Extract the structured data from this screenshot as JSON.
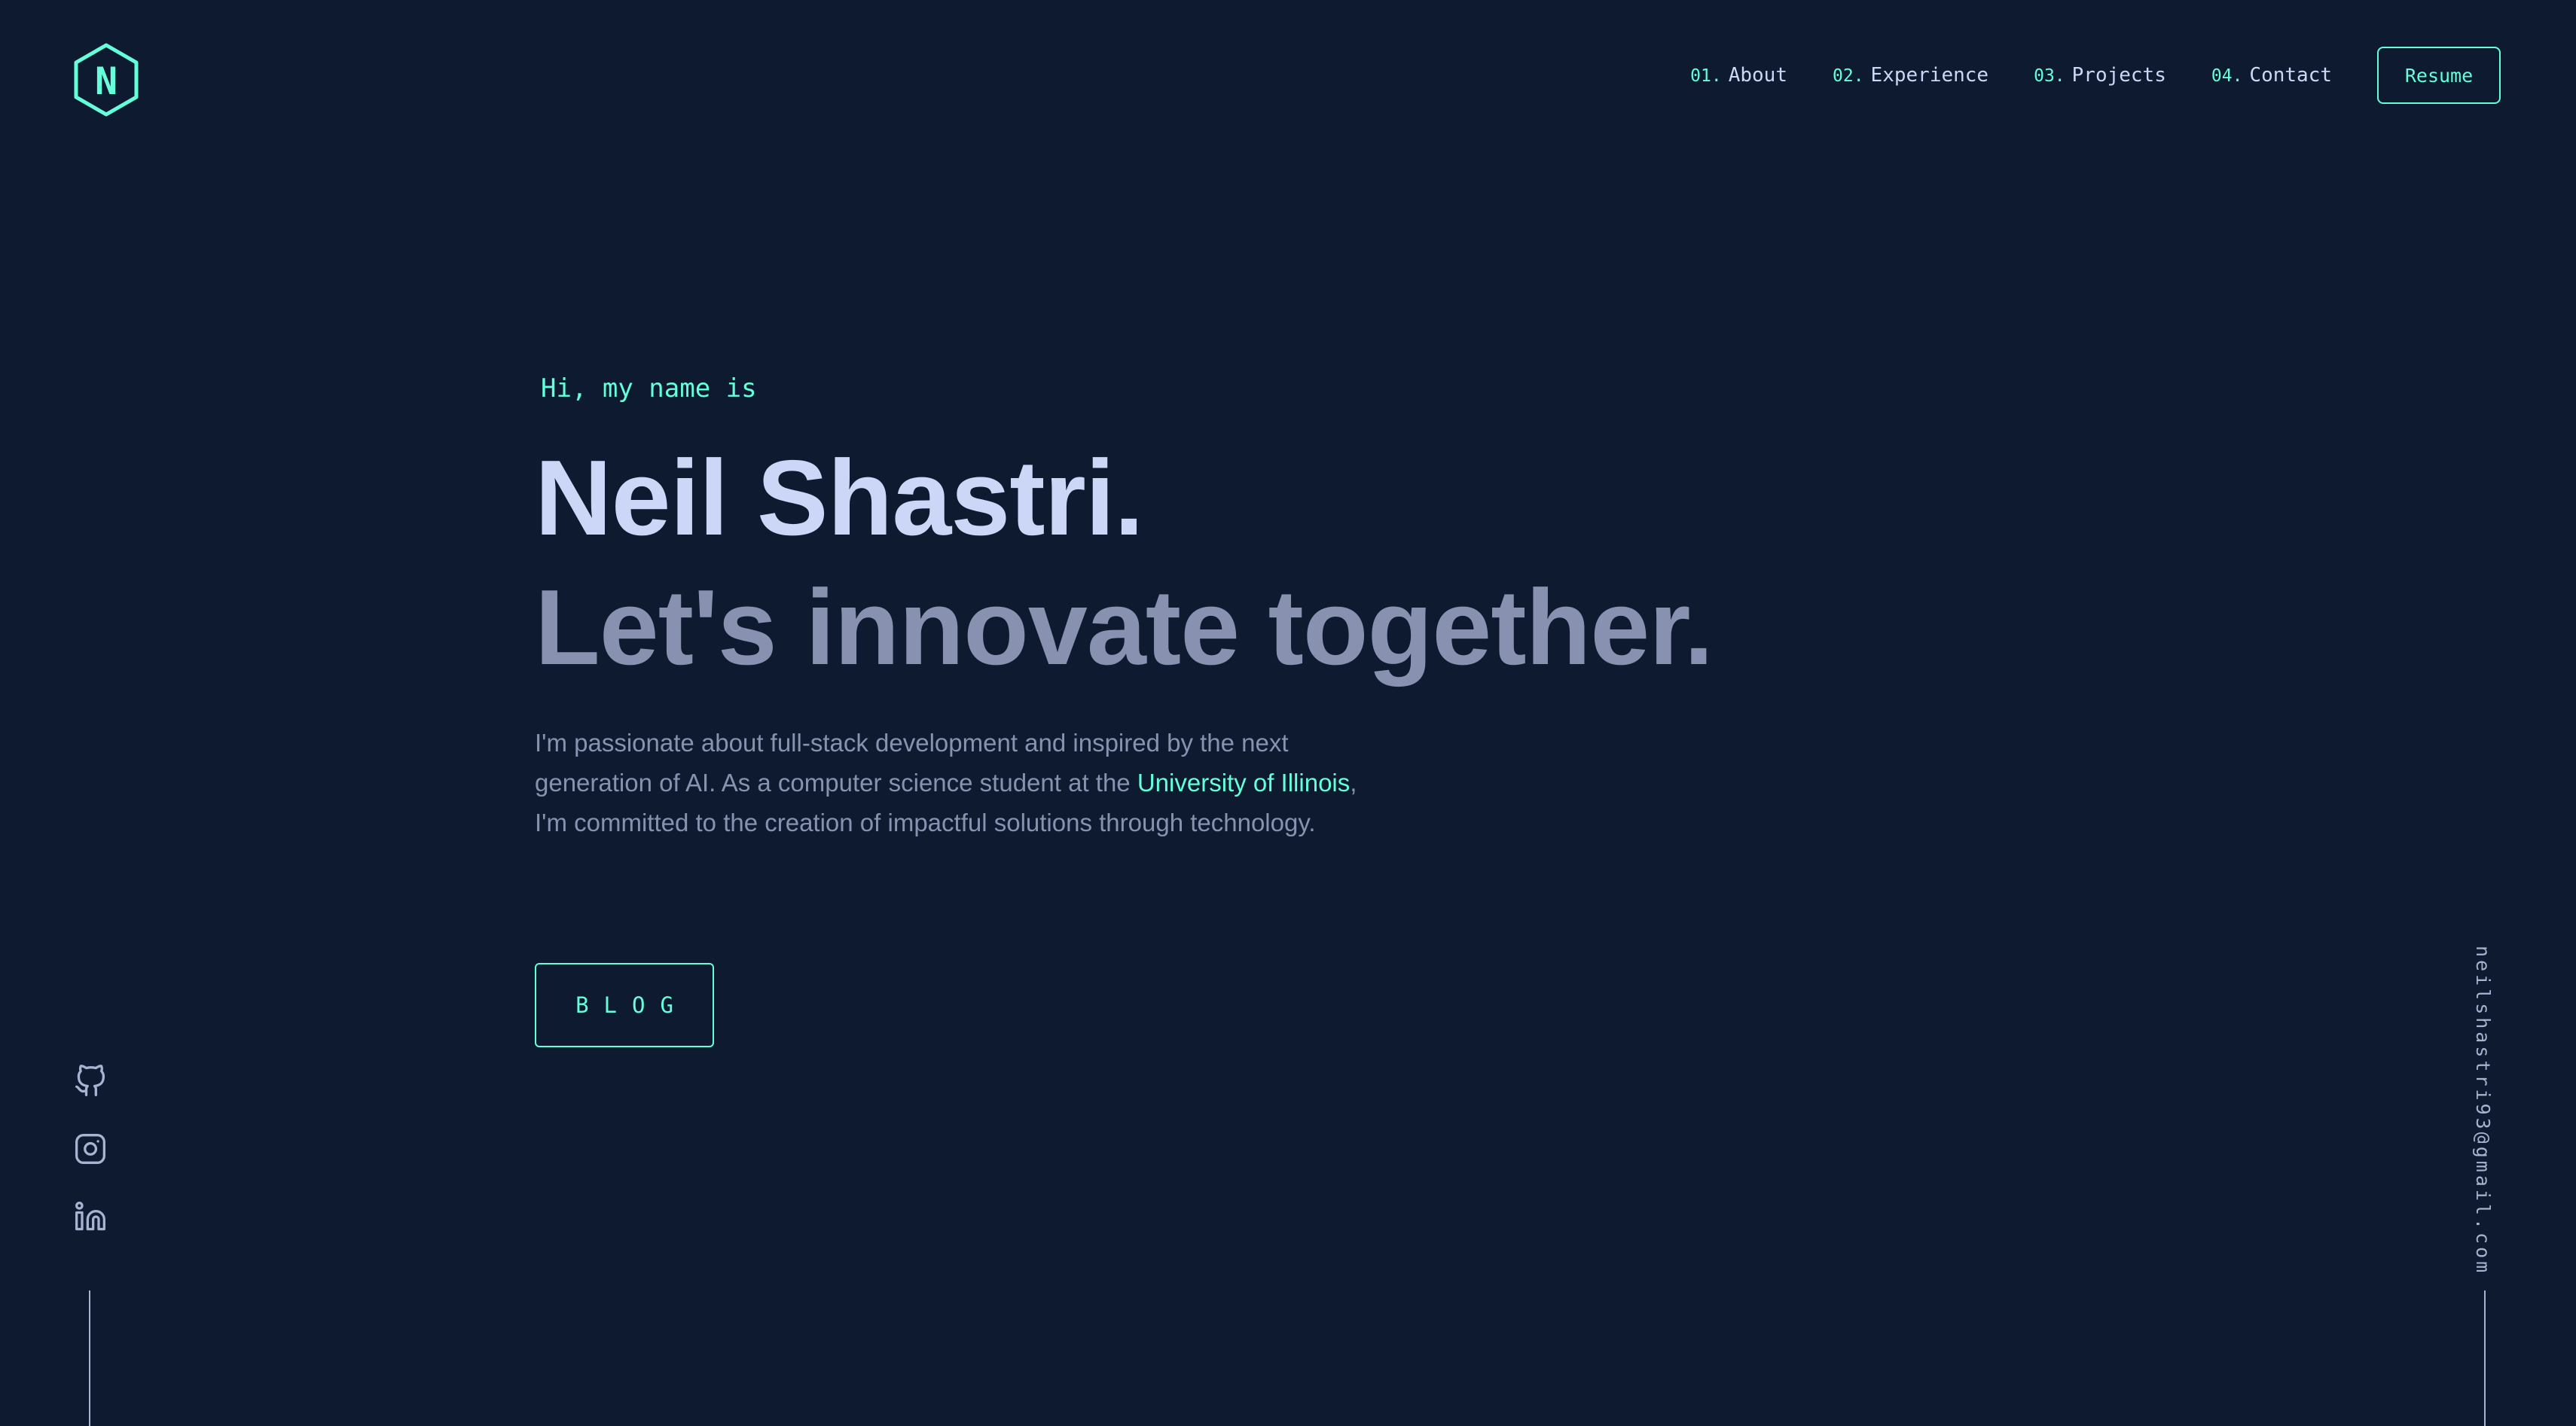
{
  "header": {
    "logo_letter": "N",
    "nav": [
      {
        "num": "01.",
        "label": "About"
      },
      {
        "num": "02.",
        "label": "Experience"
      },
      {
        "num": "03.",
        "label": "Projects"
      },
      {
        "num": "04.",
        "label": "Contact"
      }
    ],
    "resume_label": "Resume"
  },
  "hero": {
    "greeting": "Hi, my name is",
    "name": "Neil Shastri.",
    "tagline": "Let's innovate together.",
    "desc_before": "I'm passionate about full-stack development and inspired by the next generation of AI. As a computer science student at the ",
    "desc_link": "University of Illinois",
    "desc_after": ", I'm committed to the creation of impactful solutions through technology.",
    "blog_label": "BLOG"
  },
  "social": {
    "icons": [
      "github-icon",
      "instagram-icon",
      "linkedin-icon"
    ]
  },
  "email": "neilshastri93@gmail.com",
  "colors": {
    "background": "#0e1a2f",
    "accent": "#64ffda",
    "heading": "#ccd6f6",
    "muted": "#8892b0",
    "light": "#a8b2d1"
  }
}
